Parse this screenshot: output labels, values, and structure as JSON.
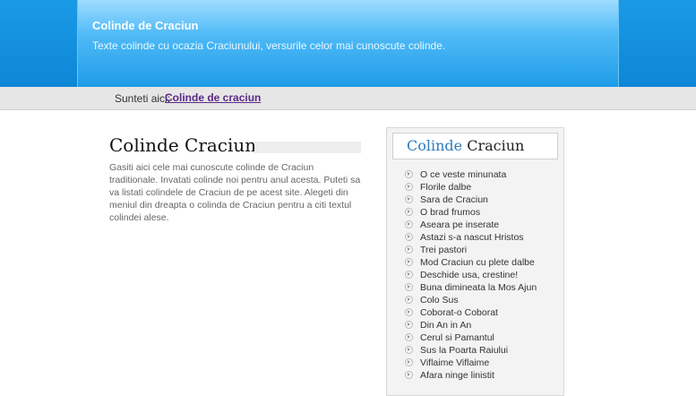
{
  "header": {
    "title": "Colinde de Craciun",
    "tagline": "Texte colinde cu ocazia Craciunului, versurile celor mai cunoscute colinde."
  },
  "breadcrumb": {
    "label": "Sunteti aici:",
    "link": "Colinde de craciun"
  },
  "main": {
    "title": "Colinde Craciun",
    "intro": "Gasiti aici cele mai cunoscute colinde de Craciun traditionale. Invatati colinde noi pentru anul acesta. Puteti sa va listati colindele de Craciun de pe acest site. Alegeti din meniul din dreapta o colinda de Craciun pentru a citi textul colindei alese."
  },
  "sidebar": {
    "heading_a": "Colinde",
    "heading_b": "Craciun",
    "items": [
      "O ce veste minunata",
      "Florile dalbe",
      "Sara de Craciun",
      "O brad frumos",
      "Aseara pe inserate",
      "Astazi s-a nascut Hristos",
      "Trei pastori",
      "Mod Craciun cu plete dalbe",
      "Deschide usa, crestine!",
      "Buna dimineata la Mos Ajun",
      "Colo Sus",
      "Coborat-o Coborat",
      "Din An in An",
      "Cerul si Pamantul",
      "Sus la Poarta Raiului",
      "Viflaime Viflaime",
      "Afara ninge linistit"
    ]
  },
  "colors": {
    "header_blue": "#1a9ae6",
    "link_purple": "#5b2a86",
    "sidebar_heading_blue": "#2a7bbf"
  }
}
